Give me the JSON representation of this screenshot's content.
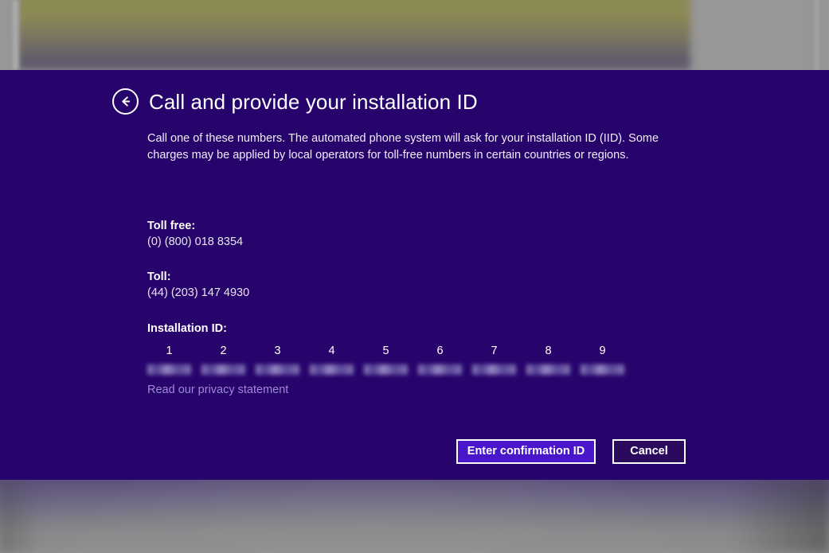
{
  "window": {
    "background_color": "#26046B",
    "accent_color": "#4a16c9",
    "link_color": "#9d8ad8"
  },
  "header": {
    "back_icon": "back-arrow-circle-icon",
    "title": "Call and provide your installation ID"
  },
  "body": {
    "intro": "Call one of these numbers. The automated phone system will ask for your installation ID (IID). Some charges may be applied by local operators for toll-free numbers in certain countries or regions.",
    "toll_free": {
      "label": "Toll free:",
      "number": "(0) (800) 018 8354"
    },
    "toll": {
      "label": "Toll:",
      "number": "(44) (203) 147 4930"
    },
    "installation_id": {
      "label": "Installation ID:",
      "groups": [
        {
          "index": "1",
          "value": ""
        },
        {
          "index": "2",
          "value": ""
        },
        {
          "index": "3",
          "value": ""
        },
        {
          "index": "4",
          "value": ""
        },
        {
          "index": "5",
          "value": ""
        },
        {
          "index": "6",
          "value": ""
        },
        {
          "index": "7",
          "value": ""
        },
        {
          "index": "8",
          "value": ""
        },
        {
          "index": "9",
          "value": ""
        }
      ]
    },
    "privacy_link": "Read our privacy statement"
  },
  "footer": {
    "primary_button": "Enter confirmation ID",
    "secondary_button": "Cancel"
  }
}
